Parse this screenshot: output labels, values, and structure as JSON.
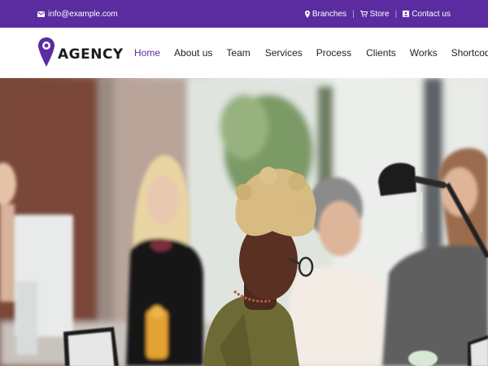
{
  "topbar": {
    "email": "info@example.com",
    "links": [
      {
        "icon": "map-pin-icon",
        "label": "Branches"
      },
      {
        "icon": "cart-icon",
        "label": "Store"
      },
      {
        "icon": "contact-icon",
        "label": "Contact us"
      }
    ],
    "background": "#5b2ca0"
  },
  "header": {
    "logo_text": "AGENCY",
    "accent": "#5b2ca0",
    "nav": [
      {
        "label": "Home",
        "active": true
      },
      {
        "label": "About us",
        "active": false
      },
      {
        "label": "Team",
        "active": false
      },
      {
        "label": "Services",
        "active": false
      },
      {
        "label": "Process",
        "active": false
      },
      {
        "label": "Clients",
        "active": false
      },
      {
        "label": "Works",
        "active": false
      },
      {
        "label": "Shortcodes",
        "active": false
      }
    ]
  }
}
